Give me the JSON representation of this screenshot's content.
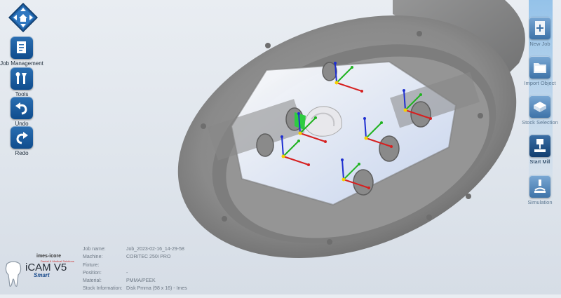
{
  "app": {
    "brand": {
      "maker": "imes-icore",
      "maker_sub": "Dental & Medical Solutions",
      "product": "iCAM V5",
      "edition": "Smart"
    }
  },
  "left_toolbar": {
    "nav_icon": "home-nav-icon",
    "items": [
      {
        "label": "Job Management",
        "icon": "document-icon"
      },
      {
        "label": "Tools",
        "icon": "tools-icon"
      },
      {
        "label": "Undo",
        "icon": "undo-icon"
      },
      {
        "label": "Redo",
        "icon": "redo-icon"
      }
    ]
  },
  "right_toolbar": {
    "items": [
      {
        "label": "New Job",
        "icon": "new-job-icon",
        "active": false
      },
      {
        "label": "Import Object",
        "icon": "folder-icon",
        "active": false
      },
      {
        "label": "Stock Selection",
        "icon": "stock-icon",
        "active": false
      },
      {
        "label": "Start Mill",
        "icon": "mill-icon",
        "active": true
      },
      {
        "label": "Simulation",
        "icon": "simulation-icon",
        "active": false
      }
    ]
  },
  "job_info": {
    "job_name_label": "Job name:",
    "job_name": "Job_2023-02-16_14-29-58",
    "machine_label": "Machine:",
    "machine": "CORiTEC 250i PRO",
    "fixture_label": "Fixture:",
    "fixture": "",
    "position_label": "Position:",
    "position": "-",
    "material_label": "Material:",
    "material": "PMMA/PEEK",
    "stock_label": "Stock Information:",
    "stock": "Disk Pmma (98 x 16) - Imes"
  },
  "colors": {
    "axis_x": "#d62020",
    "axis_y": "#21b321",
    "axis_z": "#1f2fd0",
    "toolbar_blue": "#0f4c8d"
  }
}
